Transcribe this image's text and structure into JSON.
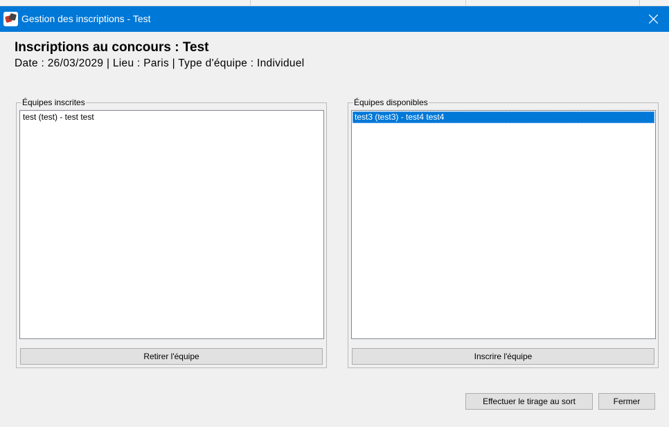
{
  "window": {
    "title": "Gestion des inscriptions - Test",
    "close_icon": "close-icon",
    "app_icon": "app-icon"
  },
  "header": {
    "title": "Inscriptions au concours : Test",
    "details": "Date : 26/03/2029 | Lieu : Paris | Type d'équipe : Individuel"
  },
  "registered": {
    "legend": "Équipes inscrites",
    "items": [
      "test (test) - test test"
    ],
    "button_label": "Retirer l'équipe"
  },
  "available": {
    "legend": "Équipes disponibles",
    "items": [
      "test3 (test3) - test4 test4"
    ],
    "selected_index": 0,
    "button_label": "Inscrire l'équipe"
  },
  "footer": {
    "draw_label": "Effectuer le tirage au sort",
    "close_label": "Fermer"
  },
  "colors": {
    "titlebar": "#0078d7",
    "selection": "#0078d7",
    "background": "#f0f0f0"
  }
}
